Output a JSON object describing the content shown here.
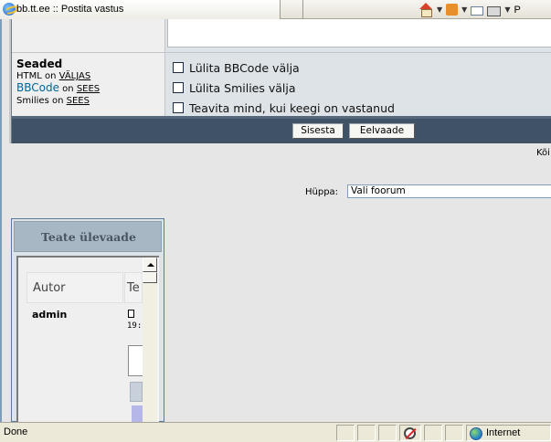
{
  "browser": {
    "tab_title": "bb.tt.ee :: Postita vastus",
    "toolbar_page_label": "P",
    "status_text": "Done",
    "zone_label": "Internet"
  },
  "settings": {
    "title": "Seaded",
    "html_prefix": "HTML on ",
    "html_state": "VÄLJAS",
    "bbcode_label": "BBCode",
    "bbcode_prefix": " on ",
    "bbcode_state": "SEES",
    "smilies_prefix": "Smilies on ",
    "smilies_state": "SEES",
    "options": [
      {
        "label": "Lülita BBCode välja",
        "checked": false
      },
      {
        "label": "Lülita Smilies välja",
        "checked": false
      },
      {
        "label": "Teavita mind, kui keegi on vastanud",
        "checked": false
      }
    ]
  },
  "buttons": {
    "submit": "Sisesta",
    "preview": "Eelvaade"
  },
  "timezone_partial": "Kõi",
  "jump": {
    "label": "Hüppa:",
    "selected": "Vali foorum"
  },
  "review": {
    "title": "Teate ülevaade",
    "col_author": "Autor",
    "col_topic_partial": "Te",
    "author": "admin",
    "time_partial": "19:"
  }
}
